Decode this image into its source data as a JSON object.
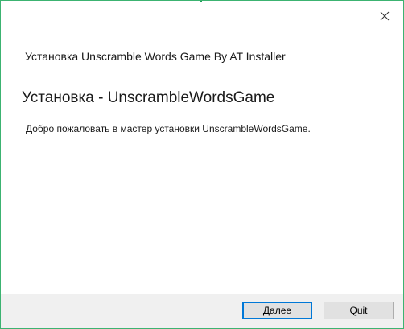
{
  "window": {
    "title": "Установка Unscramble Words Game By AT Installer",
    "close_icon": "close-icon"
  },
  "page": {
    "heading": "Установка - UnscrambleWordsGame",
    "welcome": "Добро пожаловать в мастер установки UnscrambleWordsGame."
  },
  "footer": {
    "next_label": "Далее",
    "quit_label": "Quit"
  },
  "colors": {
    "border": "#3cb371",
    "footer_bg": "#f0f0f0",
    "focus_border": "#0078d7"
  }
}
